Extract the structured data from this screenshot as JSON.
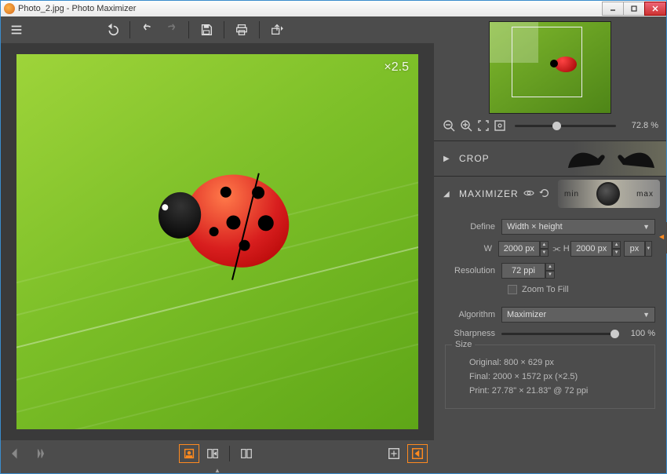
{
  "window": {
    "title": "Photo_2.jpg - Photo Maximizer"
  },
  "canvas": {
    "zoom_label": "×2.5"
  },
  "thumb": {
    "zoom_percent": "72.8 %"
  },
  "sections": {
    "crop": {
      "title": "CROP"
    },
    "maximizer": {
      "title": "MAXIMIZER",
      "knob_min": "min",
      "knob_max": "max",
      "define_label": "Define",
      "define_value": "Width × height",
      "w_label": "W",
      "w_value": "2000 px",
      "h_label": "H",
      "h_value": "2000 px",
      "unit": "px",
      "resolution_label": "Resolution",
      "resolution_value": "72 ppi",
      "zoom_to_fill": "Zoom To Fill",
      "algorithm_label": "Algorithm",
      "algorithm_value": "Maximizer",
      "sharpness_label": "Sharpness",
      "sharpness_value": "100 %",
      "size_title": "Size",
      "size_original": "Original: 800 × 629 px",
      "size_final": "Final: 2000 × 1572 px (×2.5)",
      "size_print": "Print: 27.78\" × 21.83\" @ 72 ppi"
    }
  }
}
